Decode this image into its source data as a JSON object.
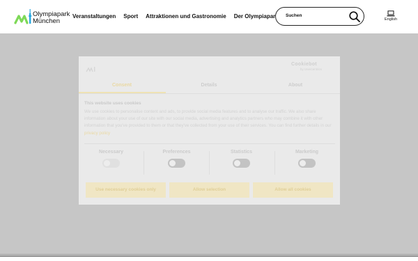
{
  "header": {
    "logo_line1": "Olympiapark",
    "logo_line2": "München",
    "nav": [
      "Veranstaltungen",
      "Sport",
      "Attraktionen und Gastronomie",
      "Der Olympiapark"
    ],
    "search_label": "Suchen",
    "language_label": "English",
    "colors": {
      "logo_green": "#7ed957",
      "logo_blue": "#2aa7e0"
    }
  },
  "dialog": {
    "cookiebot_label": "Cookiebot",
    "cookiebot_sub": "by Usercentrics",
    "tabs": [
      {
        "label": "Consent",
        "active": true
      },
      {
        "label": "Details",
        "active": false
      },
      {
        "label": "About",
        "active": false
      }
    ],
    "title": "This website uses cookies",
    "body": "We use cookies to personalise content and ads, to provide social media features and to analyse our traffic. We also share information about your use of our site with our social media, advertising and analytics partners who may combine it with other information that you've provided to them or that they've collected from your use of their services. You can find further details in our",
    "body_link": "privacy policy",
    "toggles": [
      {
        "label": "Necessary",
        "disabled": true
      },
      {
        "label": "Preferences",
        "disabled": false
      },
      {
        "label": "Statistics",
        "disabled": false
      },
      {
        "label": "Marketing",
        "disabled": false
      }
    ],
    "buttons": [
      "Use necessary cookies only",
      "Allow selection",
      "Allow all cookies"
    ],
    "colors": {
      "accent": "#ead9a3"
    }
  }
}
